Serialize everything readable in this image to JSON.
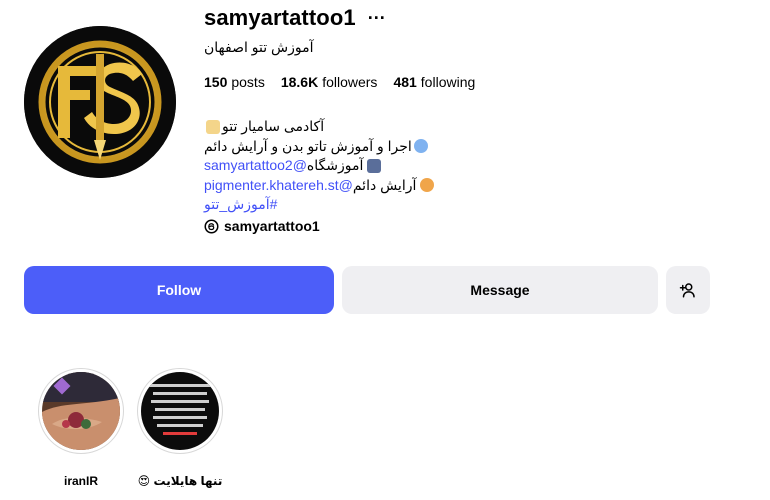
{
  "profile": {
    "username": "samyartattoo1",
    "more_label": "···",
    "subtitle": "آموزش تتو اصفهان",
    "stats": {
      "posts_count": "150",
      "posts_label": "posts",
      "followers_count": "18.6K",
      "followers_label": "followers",
      "following_count": "481",
      "following_label": "following"
    },
    "bio": {
      "line1": "آکادمی سامیار تتو",
      "line2": "اجرا و آموزش تاتو بدن و آرایش دائم",
      "line3_link": "samyartattoo2@",
      "line3_text": " آموزشگاه",
      "line4_link": "pigmenter.khatereh.st@",
      "line4_text": " آرایش دائم",
      "line5_hashtag": "#آموزش_تتو",
      "threads_handle": "samyartattoo1"
    }
  },
  "actions": {
    "follow_label": "Follow",
    "message_label": "Message"
  },
  "highlights": [
    {
      "label": "iranIR"
    },
    {
      "label": "تنها هایلایت 😍"
    }
  ],
  "colors": {
    "link": "#4150f7",
    "follow_bg": "#4c5ef9",
    "secondary_bg": "#efeff2",
    "avatar_gold": "#e6b93a"
  },
  "icons": {
    "more": "more-horizontal-icon",
    "threads": "threads-icon",
    "add_user": "add-user-icon"
  }
}
